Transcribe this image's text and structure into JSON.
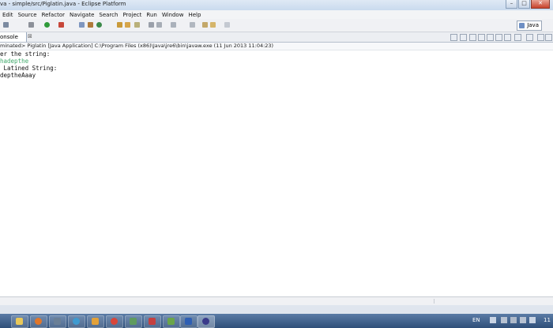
{
  "window": {
    "title": "va - simple/src/Piglatin.java - Eclipse Platform",
    "controls": {
      "minimize": "–",
      "maximize": "□",
      "close": "✕"
    }
  },
  "menu": [
    "Edit",
    "Source",
    "Refactor",
    "Navigate",
    "Search",
    "Project",
    "Run",
    "Window",
    "Help"
  ],
  "perspective": {
    "label": "Java"
  },
  "console_view": {
    "tab_label": "onsole",
    "tab_close": "⊠",
    "launch_info": "minated> Piglatin [Java Application] C:\\Program Files (x86)\\Java\\jre6\\bin\\javaw.exe (11 Jun 2013 11:04:23)",
    "lines": [
      {
        "text": "er the string:",
        "kind": "out"
      },
      {
        "text": "hadepthe",
        "kind": "in"
      },
      {
        "text": " Latined String:",
        "kind": "out"
      },
      {
        "text": "depthеAaay",
        "kind": "out"
      }
    ]
  },
  "taskbar": {
    "language": "EN",
    "clock": "11"
  },
  "colors": {
    "console_input": "#3fa86a",
    "taskbar": "#3a5a86"
  }
}
